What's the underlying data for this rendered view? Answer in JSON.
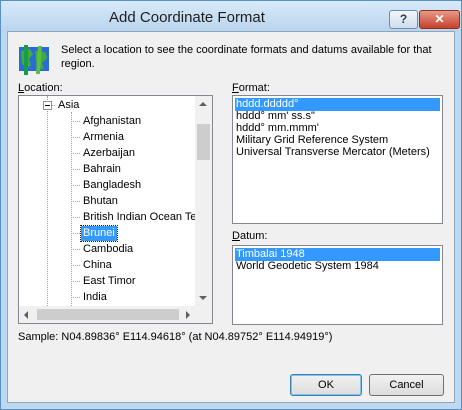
{
  "window": {
    "title": "Add Coordinate Format",
    "help_label": "?",
    "close_label": "✕"
  },
  "intro_text": "Select a location to see the coordinate formats and datums available for that region.",
  "location": {
    "label_u": "L",
    "label_rest": "ocation:",
    "parent": "Asia",
    "items": [
      "Afghanistan",
      "Armenia",
      "Azerbaijan",
      "Bahrain",
      "Bangladesh",
      "Bhutan",
      "British Indian Ocean Ter",
      "Brunei",
      "Cambodia",
      "China",
      "East Timor",
      "India"
    ],
    "selected_index": 7
  },
  "format": {
    "label_u": "F",
    "label_rest": "ormat:",
    "items": [
      "hddd.ddddd°",
      "hddd° mm' ss.s\"",
      "hddd° mm.mmm'",
      "Military Grid Reference System",
      "Universal Transverse Mercator (Meters)"
    ],
    "selected_index": 0
  },
  "datum": {
    "label_u": "D",
    "label_rest": "atum:",
    "items": [
      "Timbalai 1948",
      "World Geodetic System 1984"
    ],
    "selected_index": 0
  },
  "sample_text": "Sample: N04.89836° E114.94618° (at N04.89752° E114.94919°)",
  "buttons": {
    "ok": "OK",
    "cancel": "Cancel"
  },
  "colors": {
    "selection": "#3399ff",
    "titlebar": "#bcd9f1"
  }
}
